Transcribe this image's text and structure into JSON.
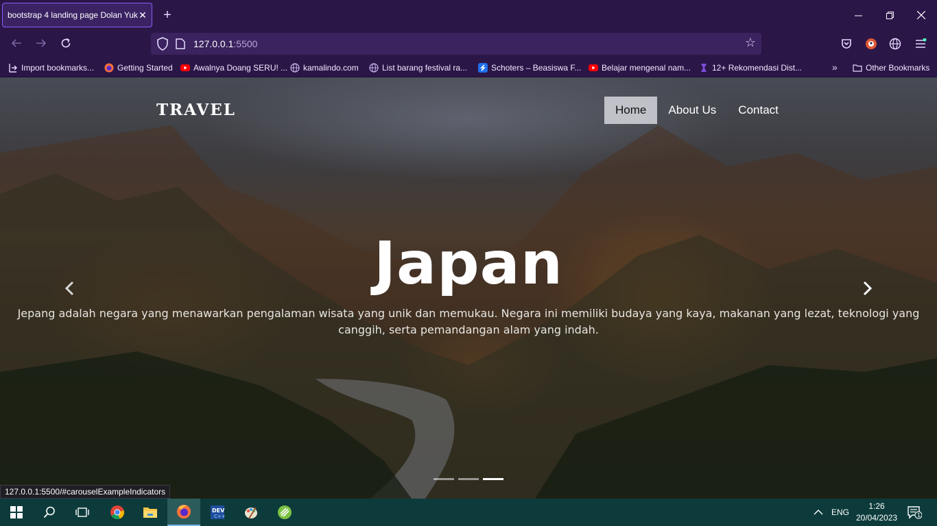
{
  "browser": {
    "tab_title": "bootstrap 4 landing page Dolan Yuk",
    "tab_close": "✕",
    "new_tab": "+",
    "url_host": "127.0.0.1",
    "url_port": ":5500",
    "bookmarks": [
      {
        "label": "Import bookmarks...",
        "icon": "import-icon",
        "color": "#e6dcff"
      },
      {
        "label": "Getting Started",
        "icon": "firefox-icon",
        "color": "#ff7139"
      },
      {
        "label": "Awalnya Doang SERU! ...",
        "icon": "youtube-icon",
        "color": "#ff0000"
      },
      {
        "label": "kamalindo.com",
        "icon": "globe-icon",
        "color": "#c9b8ec"
      },
      {
        "label": "List barang festival ra...",
        "icon": "globe-icon",
        "color": "#c9b8ec"
      },
      {
        "label": "Schoters – Beasiswa F...",
        "icon": "schoters-icon",
        "color": "#1f6feb"
      },
      {
        "label": "Belajar mengenal nam...",
        "icon": "youtube-icon",
        "color": "#ff0000"
      },
      {
        "label": "12+ Rekomendasi Dist...",
        "icon": "bookmark-site-icon",
        "color": "#7b4dd8"
      }
    ],
    "other_bookmarks": "Other Bookmarks"
  },
  "site": {
    "brand": "TRAVEL",
    "nav": [
      {
        "label": "Home",
        "active": true
      },
      {
        "label": "About Us",
        "active": false
      },
      {
        "label": "Contact",
        "active": false
      }
    ],
    "hero": {
      "title": "Japan",
      "text": "Jepang adalah negara yang menawarkan pengalaman wisata yang unik dan memukau. Negara ini memiliki budaya yang kaya, makanan yang lezat, teknologi yang canggih, serta pemandangan alam yang indah."
    },
    "carousel": {
      "slides": 3,
      "active_index": 2
    }
  },
  "status_bar": {
    "url": "127.0.0.1:5500/#carouselExampleIndicators"
  },
  "taskbar": {
    "apps": [
      "windows-start-icon",
      "search-icon",
      "task-view-icon",
      "chrome-icon",
      "file-explorer-icon",
      "firefox-icon",
      "devcpp-icon",
      "paint-icon",
      "app-icon"
    ],
    "language": "ENG",
    "time": "1:26",
    "date": "20/04/2023",
    "notifications": "1"
  },
  "colors": {
    "chrome_bg": "#2b1648",
    "urlbar_bg": "#3a235e",
    "taskbar_bg": "#0d3b3b",
    "accent": "#8a5cf6"
  }
}
